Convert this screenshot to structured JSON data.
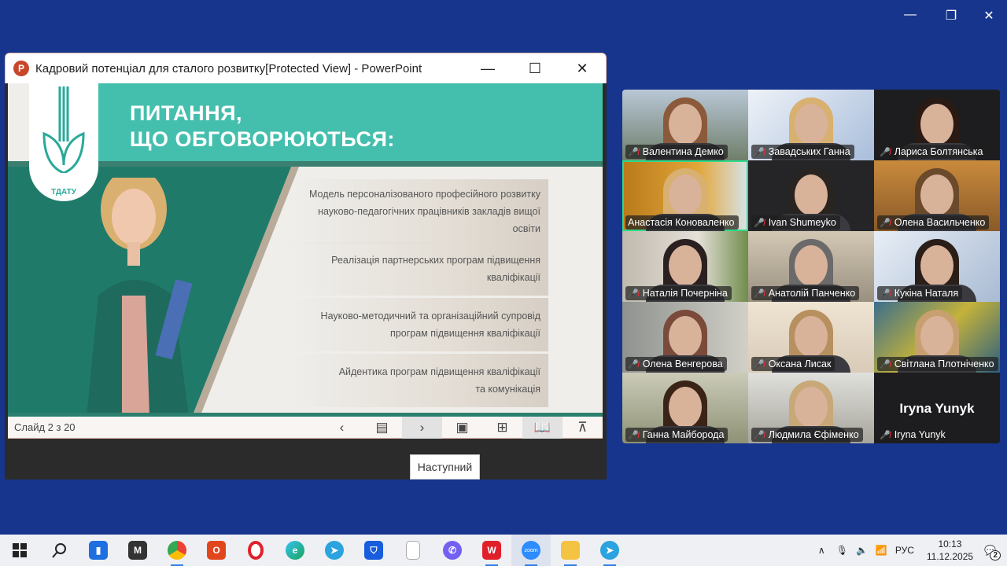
{
  "desktop": {
    "window_controls": {
      "minimize": "—",
      "restore": "❐",
      "close": "✕"
    }
  },
  "ppt": {
    "title": "Кадровий потенціал для сталого розвитку[Protected View] - PowerPoint",
    "app_icon": "P",
    "controls": {
      "minimize": "—",
      "maximize": "☐",
      "close": "✕"
    },
    "slide": {
      "logo_text": "ТДАТУ",
      "heading_line1": "ПИТАННЯ,",
      "heading_line2": "ЩО ОБГОВОРЮЮТЬСЯ:",
      "items": [
        "Модель персоналізованого професійного розвитку науково-педагогічних працівників закладів вищої освіти",
        "Реалізація партнерських програм підвищення кваліфікації",
        "Науково-методичний та організаційний супровід програм підвищення кваліфікації",
        "Айдентика програм підвищення кваліфікації та комунікація"
      ]
    },
    "status": {
      "slide_counter": "Слайд 2 з 20"
    },
    "nav": {
      "prev": "‹",
      "notes": "▤",
      "next": "›",
      "normal": "▣",
      "sorter": "⊞",
      "reading": "📖",
      "slideshow": "⊼"
    },
    "tooltip": "Наступний"
  },
  "zoom": {
    "participants": [
      {
        "name": "Валентина Демко",
        "muted": true
      },
      {
        "name": "Завадських Ганна",
        "muted": true
      },
      {
        "name": "Лариса Болтянська",
        "muted": true
      },
      {
        "name": "Анастасія Коноваленко",
        "muted": false,
        "speaking": true
      },
      {
        "name": "Ivan Shumeyko",
        "muted": true
      },
      {
        "name": "Олена Васильченко",
        "muted": true
      },
      {
        "name": "Наталія Почерніна",
        "muted": true
      },
      {
        "name": "Анатолій Панченко",
        "muted": true
      },
      {
        "name": "Кукіна Наталя",
        "muted": true
      },
      {
        "name": "Олена Венгерова",
        "muted": true
      },
      {
        "name": "Оксана Лисак",
        "muted": true
      },
      {
        "name": "Світлана Плотніченко",
        "muted": true
      },
      {
        "name": "Ганна Майборода",
        "muted": true
      },
      {
        "name": "Людмила Єфіменко",
        "muted": true
      },
      {
        "name": "Iryna Yunyk",
        "muted": true,
        "video_off": true
      }
    ]
  },
  "taskbar": {
    "apps": [
      "start",
      "search",
      "mail",
      "m",
      "chrome",
      "office",
      "opera",
      "edge",
      "telegram",
      "bitwarden",
      "file",
      "viber",
      "wps",
      "zoom",
      "explorer",
      "telegram2"
    ],
    "zoom_label": "zoom",
    "lang": "РУС",
    "time": "10:13",
    "date": "11.12.2025",
    "notifications": "2"
  }
}
